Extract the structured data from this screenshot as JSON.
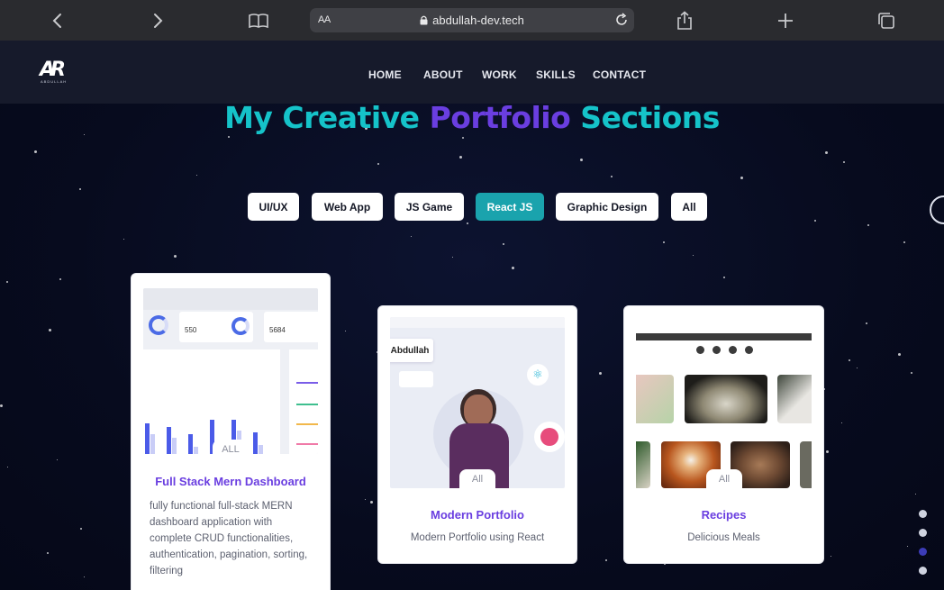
{
  "browser": {
    "url": "abdullah-dev.tech",
    "text_size_label": "AA",
    "icons": [
      "chevron-left-icon",
      "chevron-right-icon",
      "book-icon",
      "lock-icon",
      "reload-icon",
      "share-icon",
      "plus-icon",
      "tabs-icon"
    ]
  },
  "site": {
    "logo": {
      "monogram": "AR",
      "name": "ABDULLAH"
    },
    "nav": [
      {
        "label": "HOME"
      },
      {
        "label": "ABOUT"
      },
      {
        "label": "WORK"
      },
      {
        "label": "SKILLS"
      },
      {
        "label": "CONTACT"
      }
    ],
    "heading": {
      "part1": "My Creative",
      "part2": "Portfolio",
      "part3": "Sections"
    },
    "filters": [
      {
        "label": "UI/UX",
        "active": false
      },
      {
        "label": "Web App",
        "active": false
      },
      {
        "label": "JS Game",
        "active": false
      },
      {
        "label": "React JS",
        "active": true
      },
      {
        "label": "Graphic Design",
        "active": false
      },
      {
        "label": "All",
        "active": false
      }
    ],
    "projects": [
      {
        "tag": "ALL",
        "title": "Full Stack Mern Dashboard",
        "description": "fully functional full-stack MERN dashboard application with complete CRUD functionalities, authentication, pagination, sorting, filtering",
        "thumb": {
          "stat1": "550",
          "stat2": "5684"
        }
      },
      {
        "tag": "All",
        "title": "Modern Portfolio",
        "description": "Modern Portfolio using React",
        "thumb": {
          "name": "Abdullah"
        }
      },
      {
        "tag": "All",
        "title": "Recipes",
        "description": "Delicious Meals"
      }
    ],
    "page_dots": {
      "count": 4,
      "active_index": 2
    },
    "colors": {
      "accent_teal": "#15c3c9",
      "accent_purple": "#6a3ee0",
      "active_filter": "#1aa3ad",
      "background": "#070b1e"
    }
  }
}
